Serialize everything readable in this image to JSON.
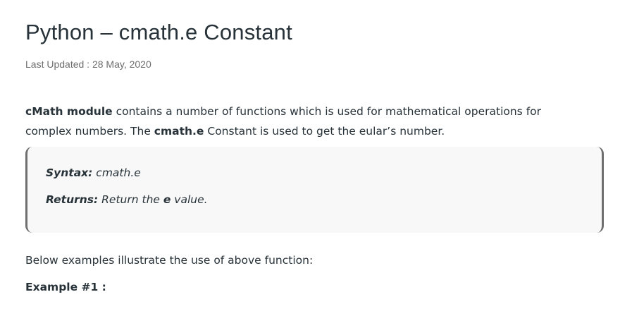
{
  "article": {
    "title": "Python – cmath.e Constant",
    "last_updated": "Last Updated : 28 May, 2020",
    "intro": {
      "bold_1": "cMath module",
      "text_1": " contains a number of functions which is used for mathematical operations for complex numbers. The ",
      "bold_2": "cmath.e",
      "text_2": " Constant is used to get the eular’s number."
    },
    "syntax_box": {
      "syntax_label": "Syntax:",
      "syntax_value": " cmath.e",
      "returns_label": "Returns:",
      "returns_text_1": " Return the ",
      "returns_bold": "e",
      "returns_text_2": " value."
    },
    "below_text": "Below examples illustrate the use of above function:",
    "example_heading": "Example #1 :"
  }
}
